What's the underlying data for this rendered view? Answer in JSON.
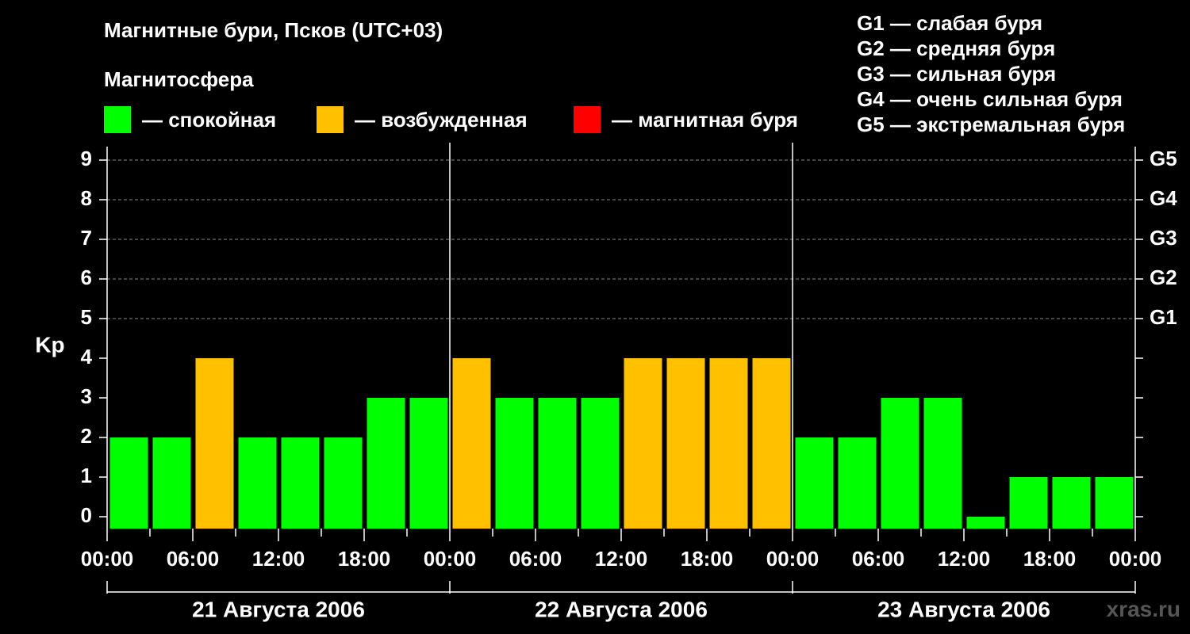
{
  "title": "Магнитные бури, Псков (UTC+03)",
  "subtitle": "Магнитосфера",
  "legend": [
    {
      "label": "— спокойная",
      "color": "#00ff00"
    },
    {
      "label": "— возбужденная",
      "color": "#ffc000"
    },
    {
      "label": "— магнитная буря",
      "color": "#ff0000"
    }
  ],
  "storm_scale": [
    "G1 — слабая буря",
    "G2 — средняя буря",
    "G3 — сильная буря",
    "G4 — очень сильная буря",
    "G5 — экстремальная буря"
  ],
  "watermark": "xras.ru",
  "chart_data": {
    "type": "bar",
    "ylabel": "Kp",
    "ylim": [
      0,
      9
    ],
    "y_ticks": [
      "0",
      "1",
      "2",
      "3",
      "4",
      "5",
      "6",
      "7",
      "8",
      "9"
    ],
    "right_ticks": [
      {
        "kp": 5,
        "label": "G1"
      },
      {
        "kp": 6,
        "label": "G2"
      },
      {
        "kp": 7,
        "label": "G3"
      },
      {
        "kp": 8,
        "label": "G4"
      },
      {
        "kp": 9,
        "label": "G5"
      }
    ],
    "x_tick_labels": [
      "00:00",
      "06:00",
      "12:00",
      "18:00",
      "00:00",
      "06:00",
      "12:00",
      "18:00",
      "00:00",
      "06:00",
      "12:00",
      "18:00",
      "00:00"
    ],
    "days": [
      "21 Августа 2006",
      "22 Августа 2006",
      "23 Августа 2006"
    ],
    "values": [
      2,
      2,
      4,
      2,
      2,
      2,
      3,
      3,
      4,
      3,
      3,
      3,
      4,
      4,
      4,
      4,
      2,
      2,
      3,
      3,
      0,
      1,
      1,
      1
    ],
    "colors": {
      "quiet": "#00ff00",
      "active": "#ffc000",
      "storm": "#ff0000"
    },
    "grid": true
  }
}
